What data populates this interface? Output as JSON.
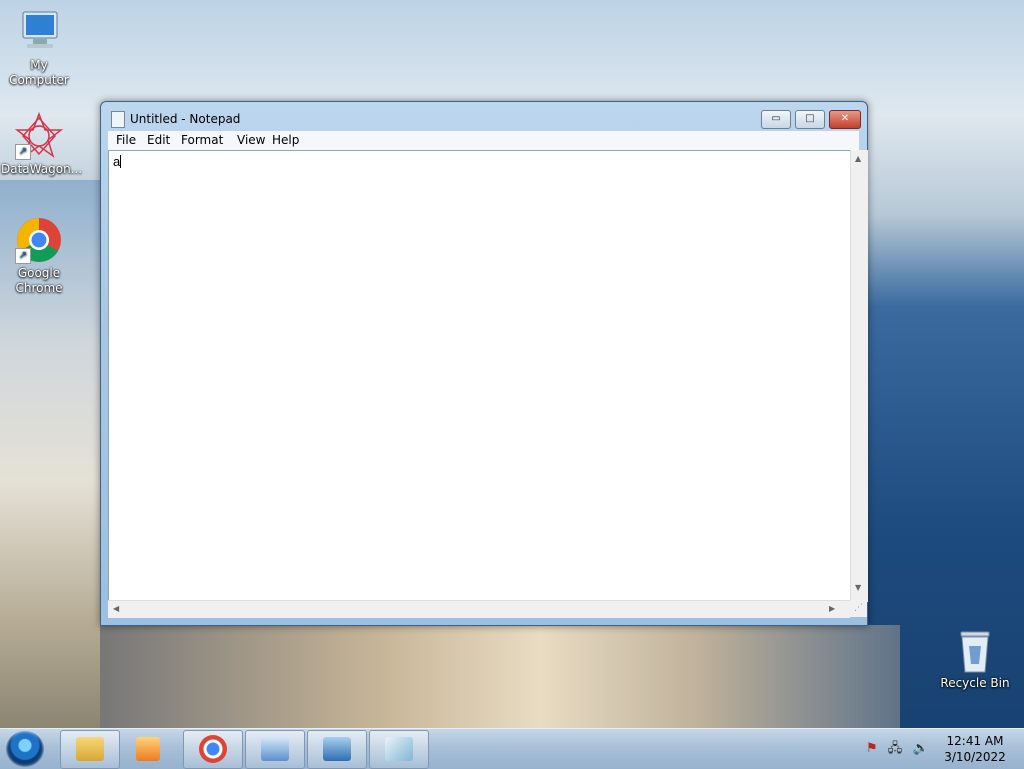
{
  "desktop": {
    "icons": [
      {
        "label": "My Computer"
      },
      {
        "label": "DataWagon..."
      },
      {
        "label": "Google Chrome"
      },
      {
        "label": "Recycle Bin"
      }
    ]
  },
  "window": {
    "title": "Untitled - Notepad",
    "controls": {
      "minimize": "▭",
      "maximize": "□",
      "close": "✕"
    },
    "menu": [
      "File",
      "Edit",
      "Format",
      "View",
      "Help"
    ],
    "content": "a"
  },
  "taskbar": {
    "pinned": [
      {
        "name": "explorer-icon",
        "color": "#e7b94a"
      },
      {
        "name": "media-player-icon",
        "color": "#f08a24"
      },
      {
        "name": "chrome-icon",
        "color": "#4285f4"
      },
      {
        "name": "control-panel-icon",
        "color": "#5b8fd1"
      },
      {
        "name": "picture-viewer-icon",
        "color": "#2f6db3"
      },
      {
        "name": "notepad-icon",
        "color": "#7fb6d6"
      }
    ],
    "time": "12:41 AM",
    "date": "3/10/2022"
  }
}
